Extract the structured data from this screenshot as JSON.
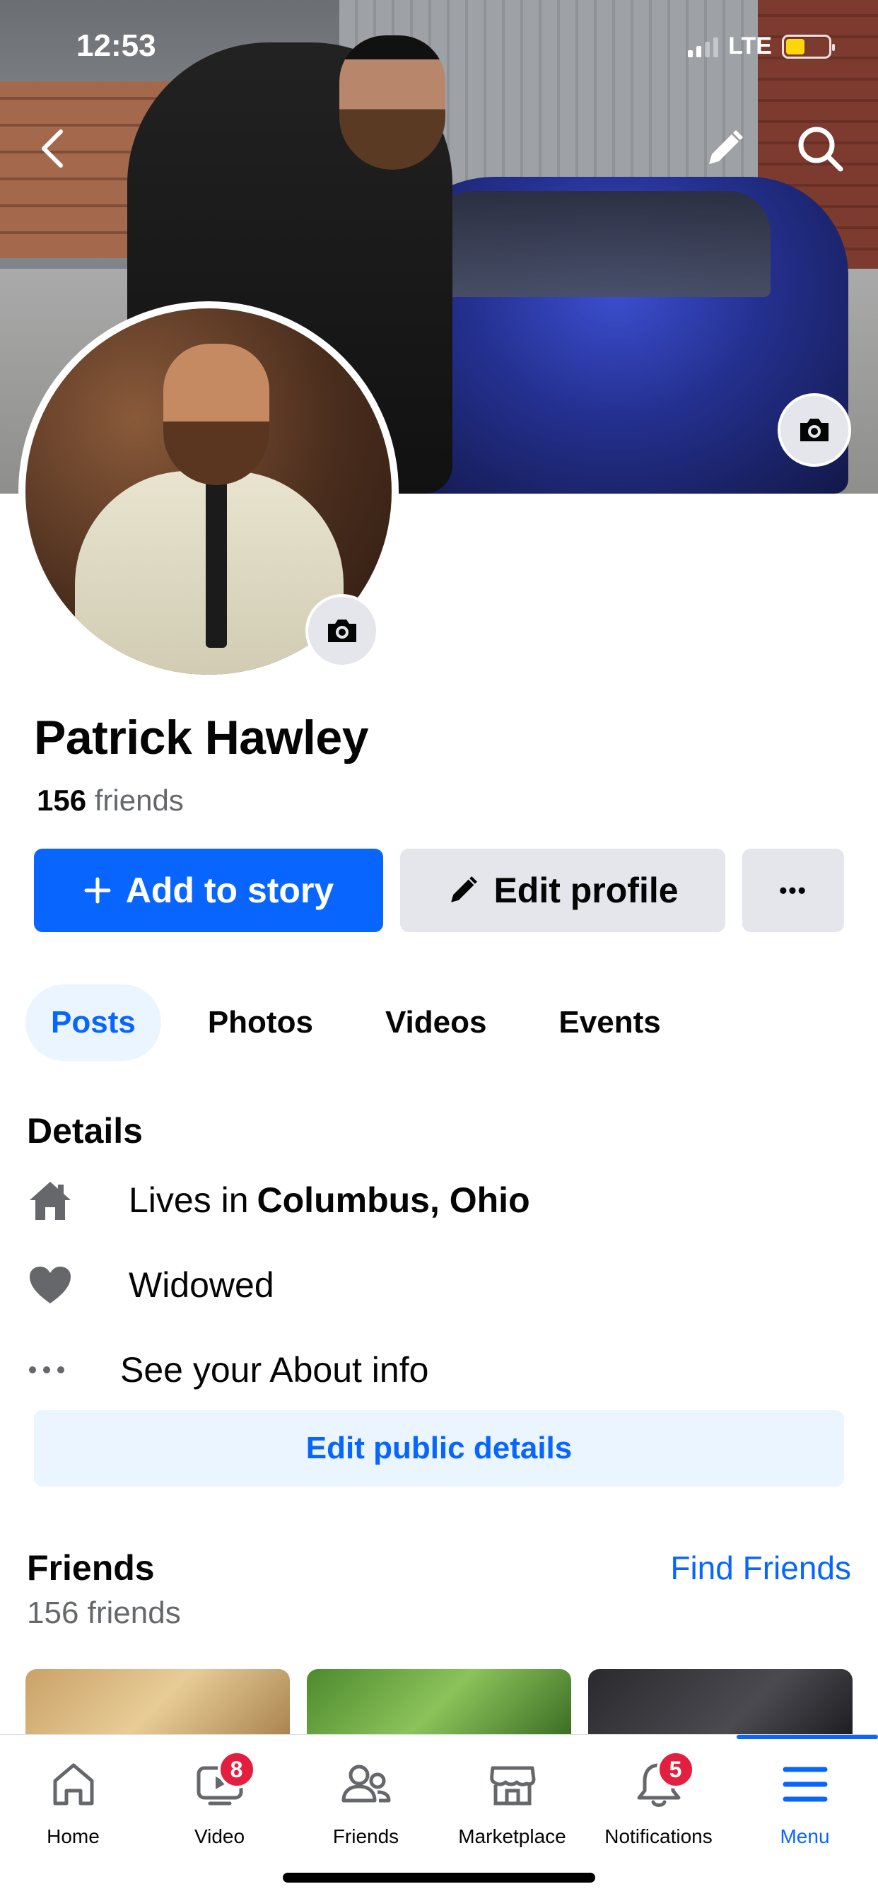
{
  "status": {
    "time": "12:53",
    "network": "LTE"
  },
  "profile": {
    "name": "Patrick Hawley",
    "friends_count": "156",
    "friends_label": "friends"
  },
  "actions": {
    "add_story": "Add to story",
    "edit_profile": "Edit profile",
    "more": "•••"
  },
  "tabs": [
    {
      "label": "Posts",
      "active": true
    },
    {
      "label": "Photos",
      "active": false
    },
    {
      "label": "Videos",
      "active": false
    },
    {
      "label": "Events",
      "active": false
    }
  ],
  "details": {
    "title": "Details",
    "lives_prefix": "Lives in",
    "lives_city": "Columbus, Ohio",
    "relationship": "Widowed",
    "about": "See your About info",
    "edit_public": "Edit public details"
  },
  "friends": {
    "title": "Friends",
    "find_link": "Find Friends",
    "subtitle": "156 friends"
  },
  "bottom_nav": [
    {
      "label": "Home",
      "icon": "home-icon",
      "badge": ""
    },
    {
      "label": "Video",
      "icon": "video-icon",
      "badge": "8"
    },
    {
      "label": "Friends",
      "icon": "friends-icon",
      "badge": ""
    },
    {
      "label": "Marketplace",
      "icon": "marketplace-icon",
      "badge": ""
    },
    {
      "label": "Notifications",
      "icon": "bell-icon",
      "badge": "5"
    },
    {
      "label": "Menu",
      "icon": "menu-icon",
      "badge": "",
      "active": true
    }
  ],
  "colors": {
    "accent": "#0866ff",
    "badge": "#e41e3f",
    "secondary_bg": "#e4e6eb",
    "battery": "#ffd60a"
  }
}
